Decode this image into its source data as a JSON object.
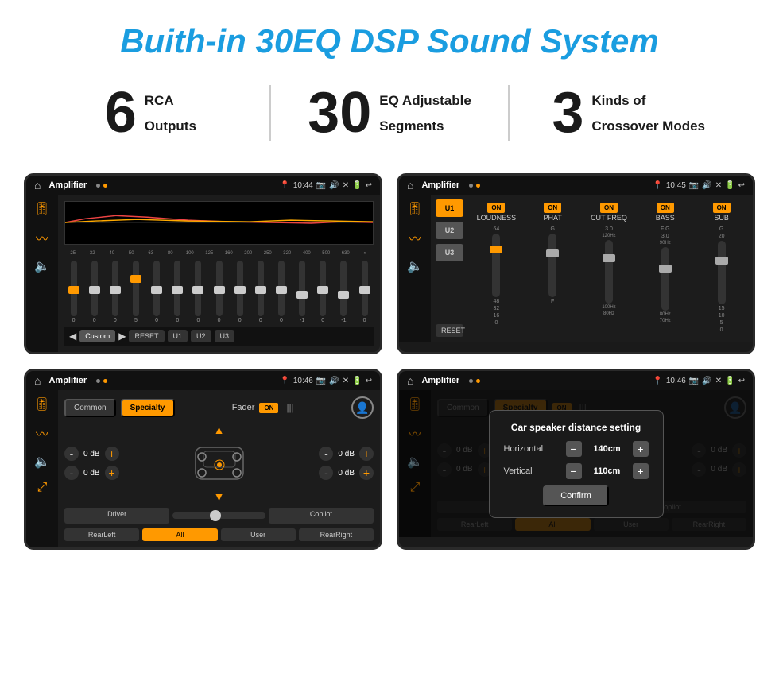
{
  "header": {
    "title": "Buith-in 30EQ DSP Sound System"
  },
  "stats": [
    {
      "number": "6",
      "line1": "RCA",
      "line2": "Outputs"
    },
    {
      "number": "30",
      "line1": "EQ Adjustable",
      "line2": "Segments"
    },
    {
      "number": "3",
      "line1": "Kinds of",
      "line2": "Crossover Modes"
    }
  ],
  "screens": [
    {
      "id": "eq-screen",
      "statusBar": {
        "home": "⌂",
        "title": "Amplifier",
        "time": "10:44"
      },
      "type": "eq",
      "eqBands": [
        "25",
        "32",
        "40",
        "50",
        "63",
        "80",
        "100",
        "125",
        "160",
        "200",
        "250",
        "320",
        "400",
        "500",
        "630"
      ],
      "eqValues": [
        "0",
        "0",
        "0",
        "5",
        "0",
        "0",
        "0",
        "0",
        "0",
        "0",
        "0",
        "-1",
        "0",
        "-1"
      ],
      "bottomButtons": [
        "Custom",
        "RESET",
        "U1",
        "U2",
        "U3"
      ]
    },
    {
      "id": "crossover-screen",
      "statusBar": {
        "home": "⌂",
        "title": "Amplifier",
        "time": "10:45"
      },
      "type": "crossover",
      "presets": [
        "U1",
        "U2",
        "U3"
      ],
      "controls": [
        "LOUDNESS",
        "PHAT",
        "CUT FREQ",
        "BASS",
        "SUB"
      ],
      "resetLabel": "RESET"
    },
    {
      "id": "fader-screen",
      "statusBar": {
        "home": "⌂",
        "title": "Amplifier",
        "time": "10:46"
      },
      "type": "fader",
      "tabs": [
        "Common",
        "Specialty"
      ],
      "faderLabel": "Fader",
      "onLabel": "ON",
      "dbValues": [
        "0 dB",
        "0 dB",
        "0 dB",
        "0 dB"
      ],
      "bottomButtons": [
        "Driver",
        "",
        "Copilot",
        "RearLeft",
        "All",
        "User",
        "RearRight"
      ]
    },
    {
      "id": "distance-screen",
      "statusBar": {
        "home": "⌂",
        "title": "Amplifier",
        "time": "10:46"
      },
      "type": "fader-modal",
      "tabs": [
        "Common",
        "Specialty"
      ],
      "modal": {
        "title": "Car speaker distance setting",
        "horizontal": {
          "label": "Horizontal",
          "value": "140cm"
        },
        "vertical": {
          "label": "Vertical",
          "value": "110cm"
        },
        "confirmLabel": "Confirm"
      },
      "bottomButtons": [
        "Driver",
        "",
        "Copilot",
        "RearLeft",
        "All",
        "User",
        "RearRight"
      ]
    }
  ]
}
